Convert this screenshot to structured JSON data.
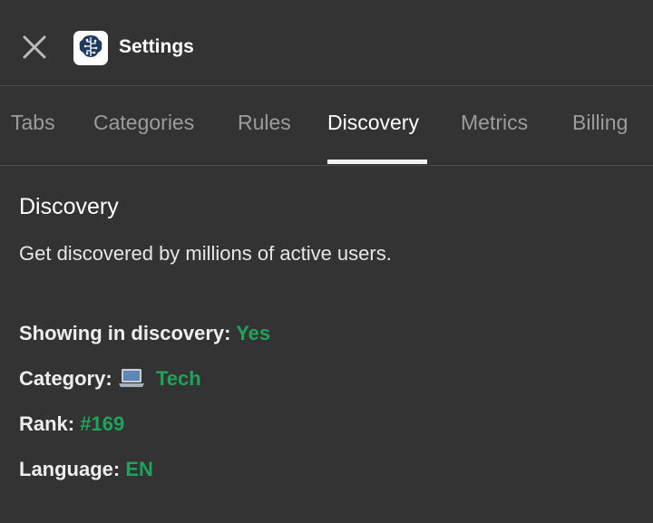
{
  "header": {
    "title": "Settings",
    "close_icon": "close-icon",
    "app_icon": "brain-circuit-icon"
  },
  "tabs": [
    {
      "label": "Tabs",
      "active": false
    },
    {
      "label": "Categories",
      "active": false
    },
    {
      "label": "Rules",
      "active": false
    },
    {
      "label": "Discovery",
      "active": true
    },
    {
      "label": "Metrics",
      "active": false
    },
    {
      "label": "Billing",
      "active": false
    }
  ],
  "discovery": {
    "title": "Discovery",
    "description": "Get discovered by millions of active users.",
    "showing_label": "Showing in discovery:",
    "showing_value": "Yes",
    "category_label": "Category:",
    "category_icon": "laptop-icon",
    "category_value": "Tech",
    "rank_label": "Rank:",
    "rank_value": "#169",
    "language_label": "Language:",
    "language_value": "EN"
  },
  "colors": {
    "background": "#333333",
    "accent_green": "#1fa35b",
    "tab_inactive": "#9c9c9c",
    "tab_active": "#ffffff"
  }
}
